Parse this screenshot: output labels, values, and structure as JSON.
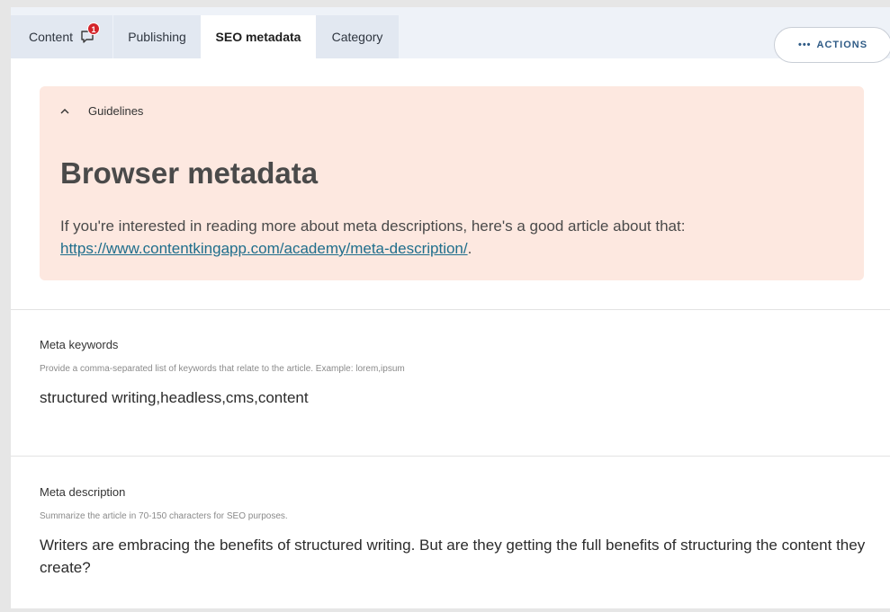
{
  "tabs": [
    {
      "label": "Content",
      "badge": "1"
    },
    {
      "label": "Publishing"
    },
    {
      "label": "SEO metadata"
    },
    {
      "label": "Category"
    }
  ],
  "actions": {
    "label": "ACTIONS",
    "dots": "•••"
  },
  "guidelines": {
    "toggle_label": "Guidelines",
    "title": "Browser metadata",
    "text_before": "If you're interested in reading more about meta descriptions, here's a good article about that: ",
    "link": "https://www.contentkingapp.com/academy/meta-description/",
    "text_after": "."
  },
  "meta_keywords": {
    "label": "Meta keywords",
    "help": "Provide a comma-separated list of keywords that relate to the article. Example: lorem,ipsum",
    "value": "structured writing,headless,cms,content"
  },
  "meta_description": {
    "label": "Meta description",
    "help": "Summarize the article in 70-150 characters for SEO purposes.",
    "value": "Writers are embracing the benefits of structured writing. But are they getting the full benefits of structuring the content they create?"
  },
  "colors": {
    "guidelines_bg": "#fde8e0",
    "badge": "#d4252b",
    "link": "#1f6e8c",
    "actions_text": "#2f5b86"
  }
}
